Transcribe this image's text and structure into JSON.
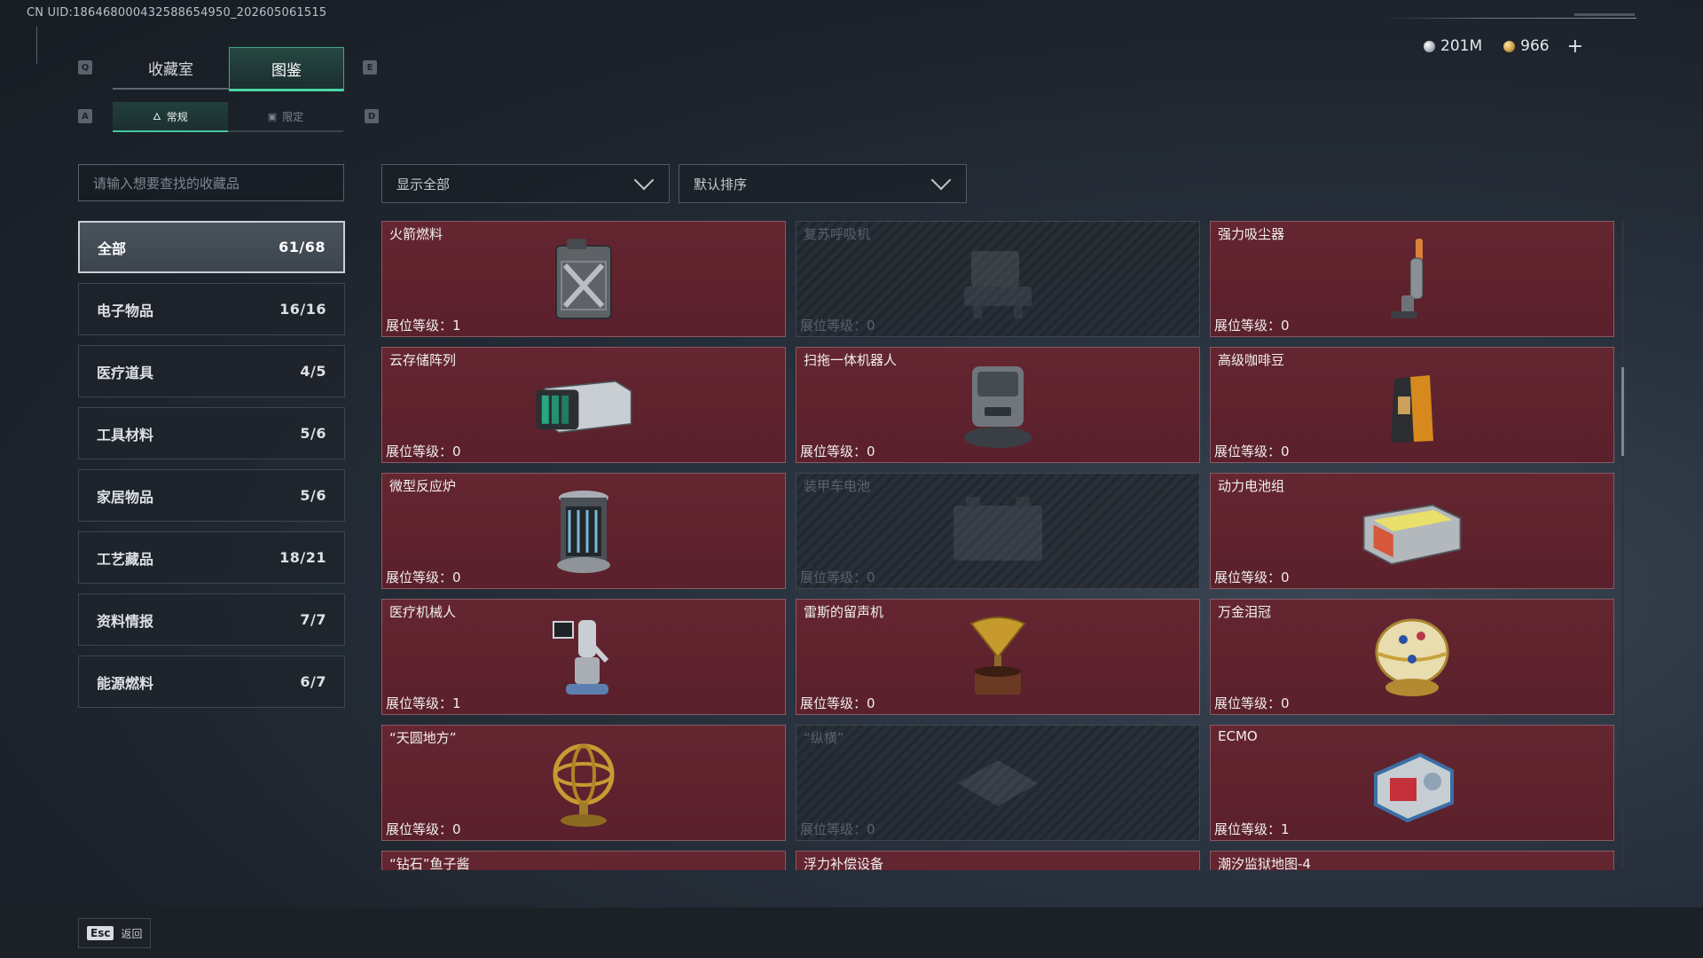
{
  "uid": "CN UID:18646800043258865495­0_202605061515",
  "currency": {
    "silver": "201M",
    "gold": "966",
    "add": "+"
  },
  "keys": {
    "prev_tab": "Q",
    "next_tab": "E",
    "prev_sub": "A",
    "next_sub": "D"
  },
  "tabs": [
    {
      "label": "收藏室",
      "active": false
    },
    {
      "label": "图鉴",
      "active": true
    }
  ],
  "subtabs": [
    {
      "label": "常规",
      "active": true
    },
    {
      "label": "限定",
      "active": false
    }
  ],
  "search": {
    "placeholder": "请输入想要查找的收藏品"
  },
  "filters": {
    "show": "显示全部",
    "sort": "默认排序"
  },
  "categories": [
    {
      "label": "全部",
      "count": "61/68",
      "active": true
    },
    {
      "label": "电子物品",
      "count": "16/16"
    },
    {
      "label": "医疗道具",
      "count": "4/5"
    },
    {
      "label": "工具材料",
      "count": "5/6"
    },
    {
      "label": "家居物品",
      "count": "5/6"
    },
    {
      "label": "工艺藏品",
      "count": "18/21"
    },
    {
      "label": "资料情报",
      "count": "7/7"
    },
    {
      "label": "能源燃料",
      "count": "6/7"
    }
  ],
  "level_prefix": "展位等级：",
  "items": [
    {
      "name": "火箭燃料",
      "level": "1",
      "locked": false,
      "icon": "fuel-canister-icon"
    },
    {
      "name": "复苏呼吸机",
      "level": "0",
      "locked": true,
      "icon": "ventilator-icon"
    },
    {
      "name": "强力吸尘器",
      "level": "0",
      "locked": false,
      "icon": "vacuum-cleaner-icon"
    },
    {
      "name": "云存储阵列",
      "level": "0",
      "locked": false,
      "icon": "storage-array-icon"
    },
    {
      "name": "扫拖一体机器人",
      "level": "0",
      "locked": false,
      "icon": "mop-robot-icon"
    },
    {
      "name": "高级咖啡豆",
      "level": "0",
      "locked": false,
      "icon": "coffee-bag-icon"
    },
    {
      "name": "微型反应炉",
      "level": "0",
      "locked": false,
      "icon": "reactor-icon"
    },
    {
      "name": "装甲车电池",
      "level": "0",
      "locked": true,
      "icon": "vehicle-battery-icon"
    },
    {
      "name": "动力电池组",
      "level": "0",
      "locked": false,
      "icon": "battery-pack-icon"
    },
    {
      "name": "医疗机械人",
      "level": "1",
      "locked": false,
      "icon": "medical-robot-icon"
    },
    {
      "name": "雷斯的留声机",
      "level": "0",
      "locked": false,
      "icon": "gramophone-icon"
    },
    {
      "name": "万金泪冠",
      "level": "0",
      "locked": false,
      "icon": "jeweled-egg-icon"
    },
    {
      "name": "“天圆地方”",
      "level": "0",
      "locked": false,
      "icon": "armillary-sphere-icon"
    },
    {
      "name": "“纵横”",
      "level": "0",
      "locked": true,
      "icon": "chess-board-icon"
    },
    {
      "name": "ECMO",
      "level": "1",
      "locked": false,
      "icon": "ecmo-machine-icon"
    },
    {
      "name": "“钻石”鱼子酱",
      "level": "",
      "locked": false,
      "icon": "caviar-icon"
    },
    {
      "name": "浮力补偿设备",
      "level": "",
      "locked": false,
      "icon": "bcd-icon"
    },
    {
      "name": "潮汐监狱地图-4",
      "level": "",
      "locked": false,
      "icon": "map-icon"
    }
  ],
  "footer": {
    "key": "Esc",
    "label": "返回"
  },
  "colors": {
    "accent": "#4bd6a5",
    "card_owned": "#5e2430",
    "card_locked": "#262c33"
  }
}
